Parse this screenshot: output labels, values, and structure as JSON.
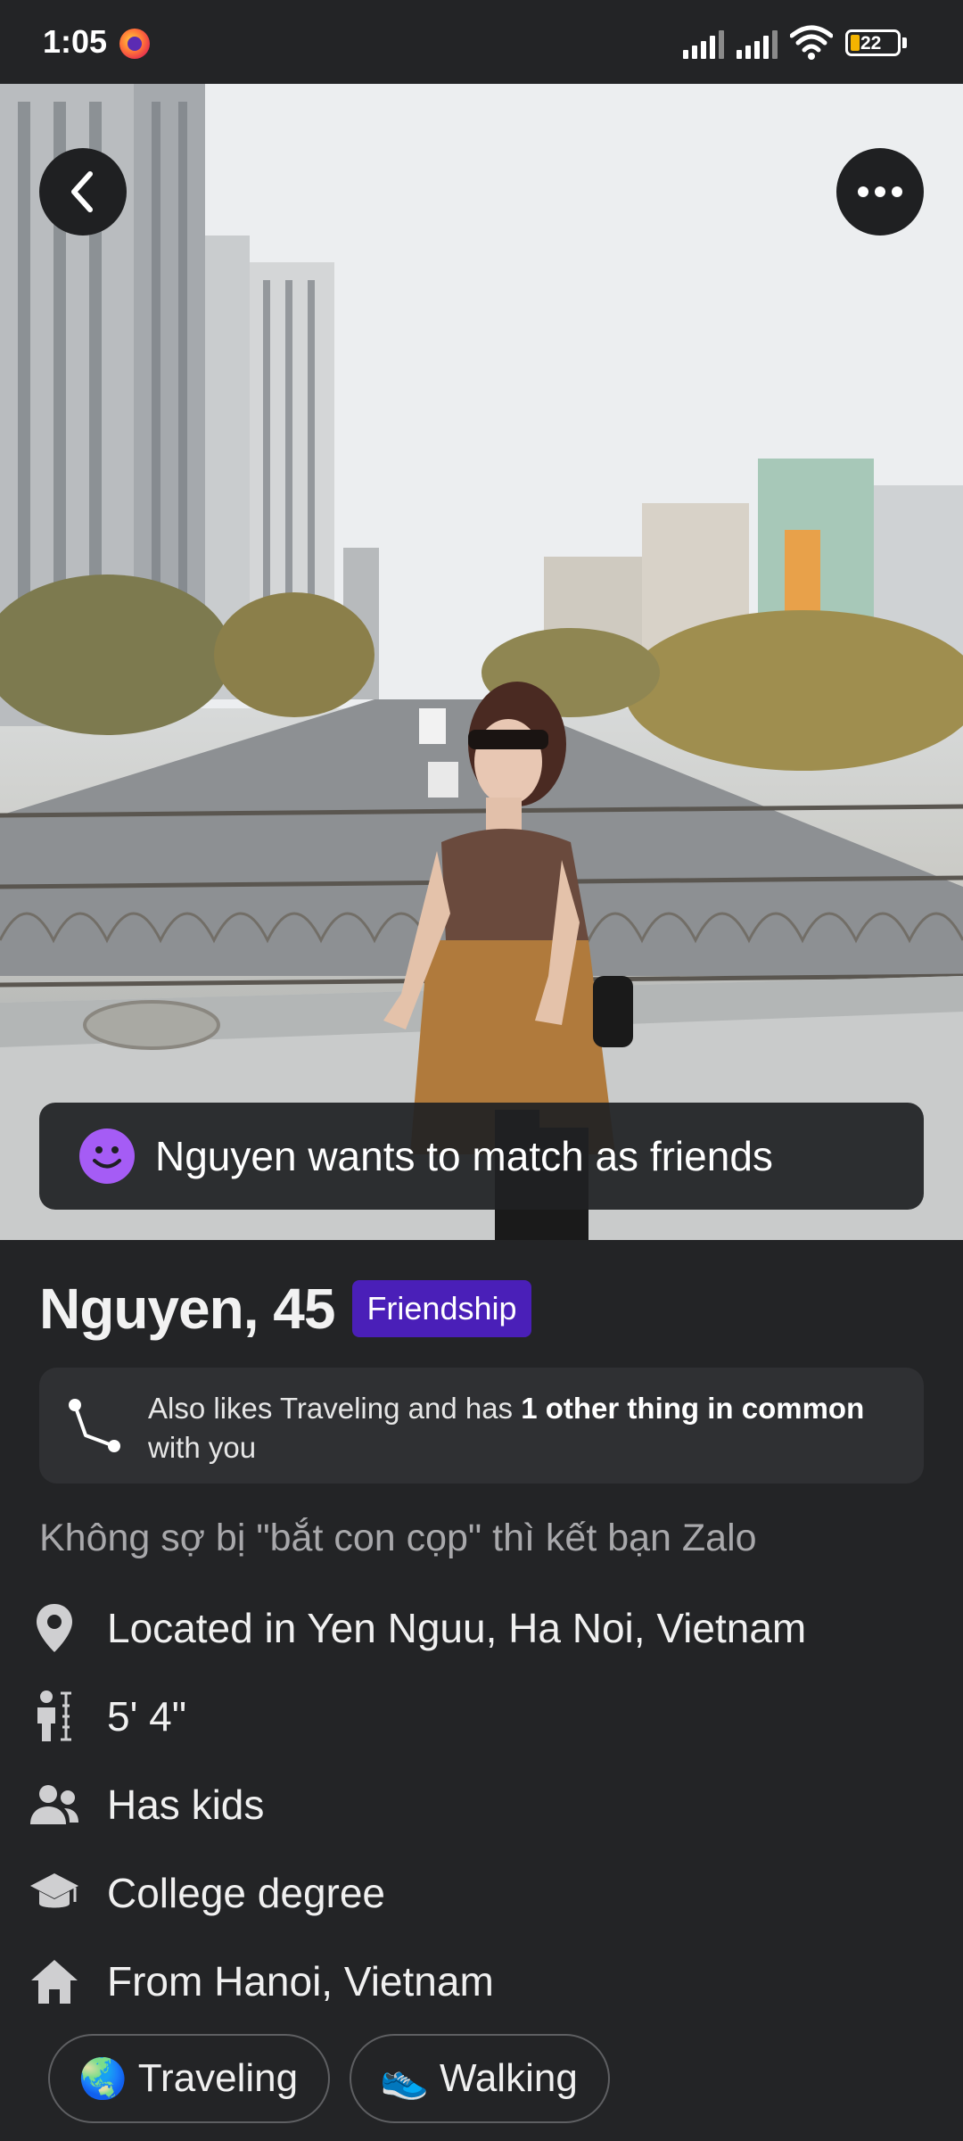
{
  "status_bar": {
    "time": "1:05",
    "battery": "22",
    "icons": [
      "firefox-icon",
      "signal-icon",
      "signal-icon",
      "wifi-icon",
      "battery-icon"
    ]
  },
  "photo": {
    "alt": "Woman in sunglasses sitting on a bridge railing above a city street",
    "back_icon": "chevron-left-icon",
    "more_icon": "more-horizontal-icon",
    "banner": {
      "icon": "smile-icon",
      "text": "Nguyen wants to match as friends"
    }
  },
  "profile": {
    "name_age": "Nguyen, 45",
    "badge": "Friendship",
    "common": {
      "icon": "connection-icon",
      "text_pre": "Also likes Traveling and has ",
      "text_bold": "1 other thing in common",
      "text_post": " with you"
    },
    "bio": "Không sợ bị \"bắt con cọp\" thì kết bạn Zalo",
    "details": [
      {
        "icon": "location-pin-icon",
        "text": "Located in Yen Nguu, Ha Noi, Vietnam"
      },
      {
        "icon": "height-icon",
        "text": "5' 4\""
      },
      {
        "icon": "people-icon",
        "text": "Has kids"
      },
      {
        "icon": "graduation-cap-icon",
        "text": "College degree"
      },
      {
        "icon": "home-icon",
        "text": "From Hanoi, Vietnam"
      }
    ],
    "interests": [
      {
        "emoji": "🌏",
        "label": "Traveling"
      },
      {
        "emoji": "👟",
        "label": "Walking"
      }
    ]
  },
  "colors": {
    "background": "#232426",
    "card": "#2f3033",
    "badge": "#4a1fb8",
    "smile": "#a55cf5",
    "muted_text": "#a8a8ab"
  }
}
